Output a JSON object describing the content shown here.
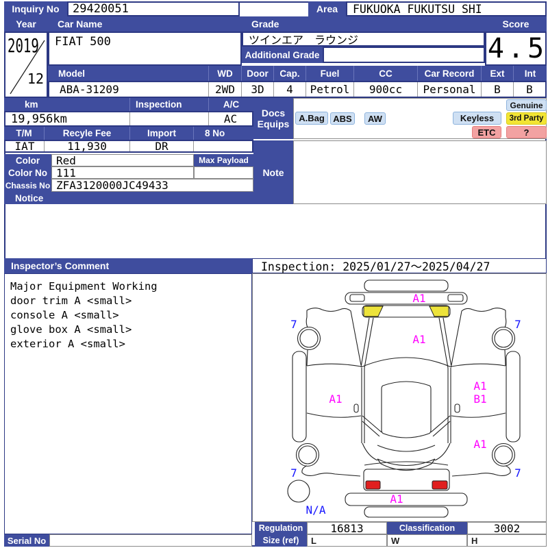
{
  "colors": {
    "header_blue": "#3f4d9e",
    "border_navy": "#2c3883",
    "badge_blue_bg": "#cfe0f3",
    "badge_yellow_bg": "#f2e535",
    "badge_pink_bg": "#f2a2a2",
    "diagram_mark_magenta": "#ff00ff",
    "diagram_mark_blue": "#1414ff",
    "highlight_yellow": "#ede33b",
    "taillight_red": "#e01f1f"
  },
  "top": {
    "inquiry_no_label": "Inquiry No",
    "inquiry_no": "29420051",
    "area_label": "Area",
    "area": "FUKUOKA FUKUTSU SHI"
  },
  "vehicle": {
    "year_label": "Year",
    "year": "2019",
    "month": "12",
    "car_name_label": "Car Name",
    "car_name": "FIAT 500",
    "grade_label": "Grade",
    "grade": "ツインエア　ラウンジ",
    "additional_grade_label": "Additional Grade",
    "additional_grade": "",
    "score_label": "Score",
    "score": "4.5",
    "model_label": "Model",
    "model": "ABA-31209",
    "wd_label": "WD",
    "wd": "2WD",
    "door_label": "Door",
    "door": "3D",
    "cap_label": "Cap.",
    "cap": "4",
    "fuel_label": "Fuel",
    "fuel": "Petrol",
    "cc_label": "CC",
    "cc": "900cc",
    "car_record_label": "Car Record",
    "car_record": "Personal",
    "ext_label": "Ext",
    "ext": "B",
    "int_label": "Int",
    "int": "B"
  },
  "details": {
    "km_label": "km",
    "km": "19,956km",
    "inspection_label": "Inspection",
    "inspection": "",
    "ac_label": "A/C",
    "ac": "AC",
    "tm_label": "T/M",
    "tm": "IAT",
    "recycle_fee_label": "Recyle Fee",
    "recycle_fee": "11,930",
    "import_label": "Import",
    "import": "DR",
    "eight_no_label": "8 No",
    "eight_no": "",
    "color_label": "Color",
    "color": "Red",
    "color_no_label": "Color No",
    "color_no": "111",
    "chassis_no_label": "Chassis No",
    "chassis_no": "ZFA3120000JC49433",
    "max_payload_label": "Max Payload",
    "max_payload": "",
    "notice_label": "Notice"
  },
  "equipment": {
    "docs_label": "Docs",
    "equips_label": "Equips",
    "note_label": "Note",
    "note": "",
    "badges": [
      {
        "label": "A.Bag",
        "style": "blue"
      },
      {
        "label": "ABS",
        "style": "blue"
      },
      {
        "label": "AW",
        "style": "blue"
      },
      {
        "label": "Keyless",
        "style": "blue"
      },
      {
        "label": "Genuine",
        "style": "blue"
      },
      {
        "label": "3rd Party",
        "style": "yellow"
      },
      {
        "label": "ETC",
        "style": "pink"
      },
      {
        "label": "?",
        "style": "pink"
      }
    ]
  },
  "comment": {
    "title": "Inspector’s Comment",
    "lines": [
      "Major Equipment Working",
      "door trim A <small>",
      "console A <small>",
      "glove box A <small>",
      "exterior A <small>"
    ]
  },
  "inspection_period": "Inspection: 2025/01/27～2025/04/27",
  "diagram": {
    "front_bumper_mark": "A1",
    "hood_mark": "A1",
    "left_door_mark": "A1",
    "right_door_mark_line1": "A1",
    "right_door_mark_line2": "B1",
    "right_quarter_mark": "A1",
    "rear_bumper_mark": "A1",
    "front_left_wheel_mark": "7",
    "front_right_wheel_mark": "7",
    "rear_left_wheel_mark": "7",
    "rear_right_wheel_mark": "7",
    "spare_tire_mark": "N/A"
  },
  "footer": {
    "regulation_label": "Regulation",
    "regulation": "16813",
    "classification_label": "Classification",
    "classification": "3002",
    "size_label": "Size (ref)",
    "size_l_label": "L",
    "size_w_label": "W",
    "size_h_label": "H",
    "serial_label": "Serial No",
    "serial": ""
  }
}
